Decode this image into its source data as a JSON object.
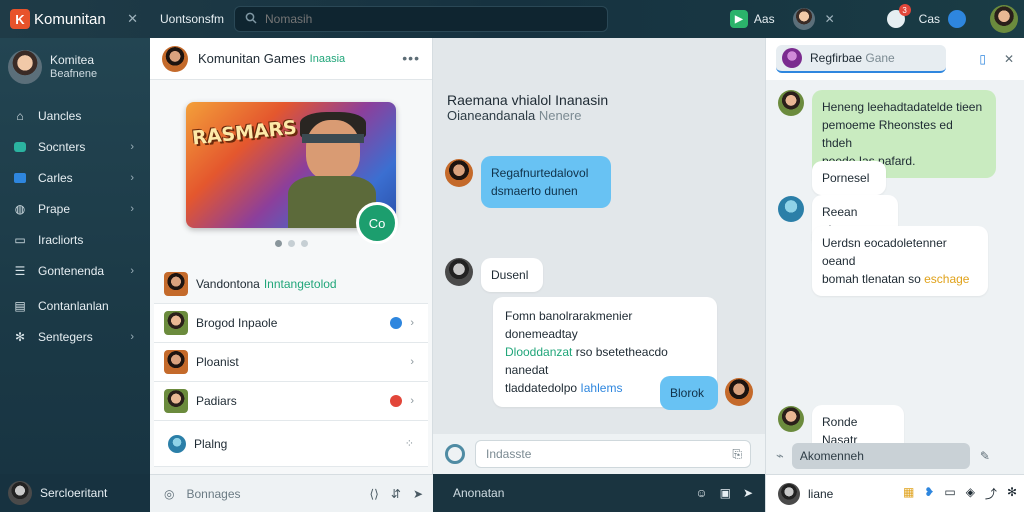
{
  "topbar": {
    "brand": "Komunitan",
    "title": "Uontsonsfm",
    "search_placeholder": "Nomasih",
    "chip": "Aas",
    "user_label": "Cas",
    "notif_badge": "3"
  },
  "sidebar": {
    "profile_name": "Komitea",
    "profile_sub": "Beafnene",
    "items": [
      {
        "label": "Uancles",
        "icon": "home-icon",
        "chevron": false
      },
      {
        "label": "Socnters",
        "icon": "chat-icon",
        "chevron": true
      },
      {
        "label": "Carles",
        "icon": "card-icon",
        "chevron": true
      },
      {
        "label": "Prape",
        "icon": "people-icon",
        "chevron": true
      },
      {
        "label": "Iracliorts",
        "icon": "document-icon",
        "chevron": false
      },
      {
        "label": "Gontenenda",
        "icon": "list-icon",
        "chevron": true
      },
      {
        "label": "Contanlanlan",
        "icon": "calendar-icon",
        "chevron": false
      },
      {
        "label": "Sentegers",
        "icon": "gear-icon",
        "chevron": true
      }
    ],
    "bottom_user": "Sercloeritant"
  },
  "community": {
    "title": "Komunitan Games",
    "tag": "Inaasia",
    "banner_logo": "RASMARS",
    "badge": "Co",
    "rows": [
      {
        "label": "Vandontona",
        "highlight": "Inntangetolod",
        "indicator": "none"
      },
      {
        "label": "Brogod Inpaole",
        "highlight": "",
        "indicator": "blue"
      },
      {
        "label": "Ploanist",
        "highlight": "",
        "indicator": "none"
      },
      {
        "label": "Padiars",
        "highlight": "",
        "indicator": "red"
      },
      {
        "label": "Plalng",
        "highlight": "",
        "indicator": "none"
      }
    ],
    "footer_placeholder": "Bonnages"
  },
  "chat": {
    "title": "Raemana vhialol Inanasin",
    "subtitle": "Oianeandanala",
    "subtitle_muted": "Nenere",
    "messages": [
      {
        "line1": "Regafnurtedalovol",
        "line2": "dsmaerto dunen"
      },
      {
        "text": "Dusenl"
      },
      {
        "line1": "Fomn banolrarakmenier donemeadtay",
        "line2_hl": "Dlooddanzat",
        "line2": "rso bsetetheacdo nanedat",
        "line3": "tladdatedolpo",
        "line3_hl": "Iahlems"
      },
      {
        "text": "Blorok"
      }
    ],
    "composer_placeholder": "Indasste",
    "footer_text": "Anonatan"
  },
  "panel": {
    "tab_name": "Regfirbae",
    "tab_muted": "Gane",
    "messages": [
      {
        "lines": [
          "Heneng leehadtadatelde tieen",
          "pemoeme Rheonstes ed thdeh",
          "poede Ias pafard."
        ]
      },
      {
        "lines": [
          "Pornesel"
        ]
      },
      {
        "lines": [
          "Reean alanto"
        ]
      },
      {
        "line1": "Uerdsn eocadoletenner oeand",
        "line2": "bomah tlenatan so",
        "line2_hl": "eschage"
      },
      {
        "lines": [
          "Ronde Nasatr"
        ]
      }
    ],
    "composer_value": "Akomenneh",
    "footer_name": "liane"
  }
}
